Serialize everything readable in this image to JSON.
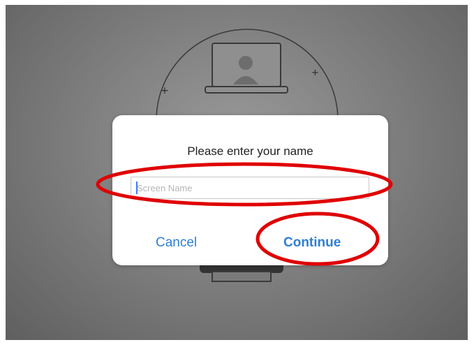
{
  "dialog": {
    "title": "Please enter your name",
    "input_placeholder": "Screen Name",
    "input_value": "",
    "cancel_label": "Cancel",
    "continue_label": "Continue"
  },
  "colors": {
    "accent": "#2e7fd4",
    "highlight": "#e00000",
    "overlay": "#808080"
  }
}
